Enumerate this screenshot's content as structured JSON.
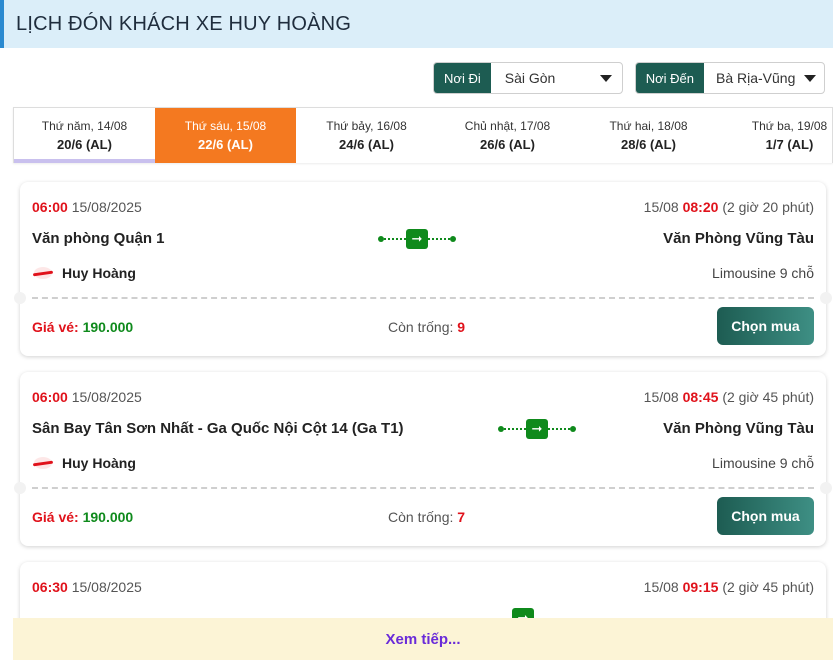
{
  "header": {
    "title": "LỊCH ĐÓN KHÁCH XE HUY HOÀNG"
  },
  "filters": {
    "from": {
      "label": "Nơi Đi",
      "value": "Sài Gòn"
    },
    "to": {
      "label": "Nơi Đến",
      "value": "Bà Rịa-Vũng"
    }
  },
  "dates": [
    {
      "day": "Thứ năm, 14/08",
      "lunar": "20/6 (AL)"
    },
    {
      "day": "Thứ sáu, 15/08",
      "lunar": "22/6 (AL)",
      "active": true
    },
    {
      "day": "Thứ bảy, 16/08",
      "lunar": "24/6 (AL)"
    },
    {
      "day": "Chủ nhật, 17/08",
      "lunar": "26/6 (AL)"
    },
    {
      "day": "Thứ hai, 18/08",
      "lunar": "28/6 (AL)"
    },
    {
      "day": "Thứ ba, 19/08",
      "lunar": "1/7 (AL)"
    }
  ],
  "trips": [
    {
      "depart_time": "06:00",
      "depart_date": "15/08/2025",
      "arrive_date": "15/08",
      "arrive_time": "08:20",
      "duration": "(2 giờ 20 phút)",
      "origin": "Văn phòng Quận 1",
      "destination": "Văn Phòng Vũng Tàu",
      "operator": "Huy Hoàng",
      "vehicle": "Limousine 9 chỗ",
      "price_label": "Giá vé:",
      "price": "190.000",
      "seats_label": "Còn trống:",
      "seats": "9",
      "buy_label": "Chọn mua"
    },
    {
      "depart_time": "06:00",
      "depart_date": "15/08/2025",
      "arrive_date": "15/08",
      "arrive_time": "08:45",
      "duration": "(2 giờ 45 phút)",
      "origin": "Sân Bay Tân Sơn Nhất - Ga Quốc Nội Cột 14 (Ga T1)",
      "destination": "Văn Phòng Vũng Tàu",
      "operator": "Huy Hoàng",
      "vehicle": "Limousine 9 chỗ",
      "price_label": "Giá vé:",
      "price": "190.000",
      "seats_label": "Còn trống:",
      "seats": "7",
      "buy_label": "Chọn mua"
    },
    {
      "depart_time": "06:30",
      "depart_date": "15/08/2025",
      "arrive_date": "15/08",
      "arrive_time": "09:15",
      "duration": "(2 giờ 45 phút)"
    }
  ],
  "more": {
    "label": "Xem tiếp..."
  },
  "colors": {
    "accent": "#1d5c52",
    "active_tab": "#f47920",
    "price": "#0f8a1c",
    "alert": "#e0121b",
    "more_link": "#6a2bd9"
  }
}
